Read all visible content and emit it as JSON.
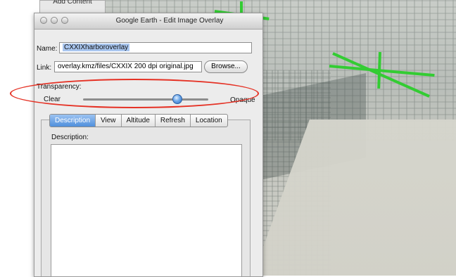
{
  "background_tab": {
    "label": "Add Content"
  },
  "window": {
    "title": "Google Earth - Edit Image Overlay",
    "traffic_lights": [
      "close",
      "minimize",
      "zoom"
    ]
  },
  "form": {
    "name_label": "Name:",
    "name_value": "CXXIXharboroverlay",
    "link_label": "Link:",
    "link_value": "overlay.kmz/files/CXXIX 200 dpi original.jpg",
    "browse_label": "Browse...",
    "transparency_label": "Transparency:",
    "clear_label": "Clear",
    "opaque_label": "Opaque",
    "transparency_value": 0.75
  },
  "tabs": [
    {
      "label": "Description",
      "active": true
    },
    {
      "label": "View",
      "active": false
    },
    {
      "label": "Altitude",
      "active": false
    },
    {
      "label": "Refresh",
      "active": false
    },
    {
      "label": "Location",
      "active": false
    }
  ],
  "description": {
    "label": "Description:",
    "value": ""
  },
  "colors": {
    "highlight_oval": "#e53124",
    "overlay_lines": "#33cc33",
    "selection": "#a9c6ef"
  }
}
